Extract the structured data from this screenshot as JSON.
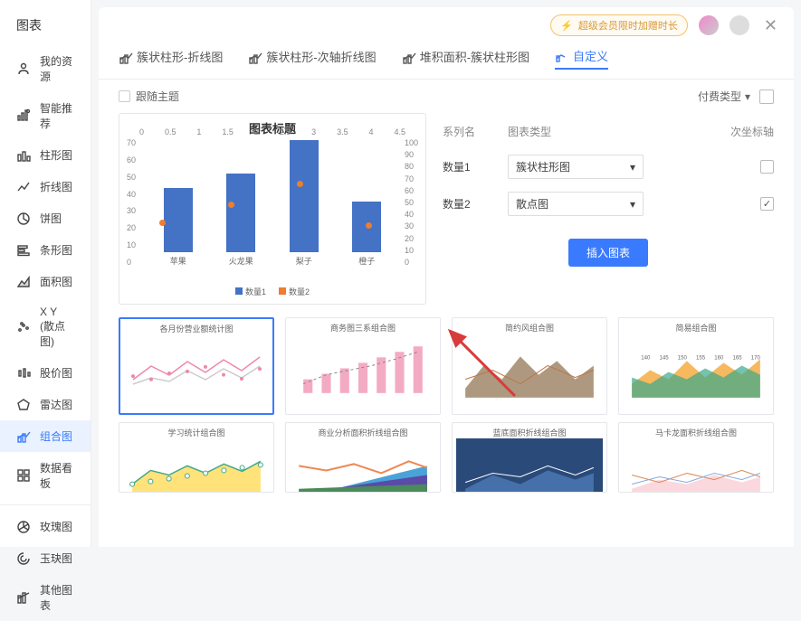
{
  "sidebar": {
    "title": "图表",
    "items": [
      {
        "label": "我的资源",
        "icon": "user"
      },
      {
        "label": "智能推荐",
        "icon": "sparkle"
      },
      {
        "label": "柱形图",
        "icon": "bar"
      },
      {
        "label": "折线图",
        "icon": "line"
      },
      {
        "label": "饼图",
        "icon": "pie"
      },
      {
        "label": "条形图",
        "icon": "hbar"
      },
      {
        "label": "面积图",
        "icon": "area"
      },
      {
        "label": "X Y (散点图)",
        "icon": "scatter"
      },
      {
        "label": "股价图",
        "icon": "stock"
      },
      {
        "label": "雷达图",
        "icon": "radar"
      },
      {
        "label": "组合图",
        "icon": "combo",
        "active": true
      },
      {
        "label": "数据看板",
        "icon": "dashboard"
      }
    ],
    "items2": [
      {
        "label": "玫瑰图",
        "icon": "rose"
      },
      {
        "label": "玉玦图",
        "icon": "jade"
      },
      {
        "label": "其他图表",
        "icon": "other"
      }
    ]
  },
  "header": {
    "vip_text": "超级会员限时加赠时长"
  },
  "tabs": [
    {
      "label": "簇状柱形-折线图"
    },
    {
      "label": "簇状柱形-次轴折线图"
    },
    {
      "label": "堆积面积-簇状柱形图"
    },
    {
      "label": "自定义",
      "active": true
    }
  ],
  "toolbar": {
    "follow_theme": "跟随主题",
    "pay_type": "付费类型"
  },
  "chart_data": {
    "type": "bar",
    "title": "图表标题",
    "categories": [
      "苹果",
      "火龙果",
      "梨子",
      "橙子"
    ],
    "series": [
      {
        "name": "数量1",
        "type": "bar",
        "values": [
          38,
          47,
          67,
          30
        ]
      },
      {
        "name": "数量2",
        "type": "scatter",
        "values": [
          35,
          50,
          68,
          32
        ]
      }
    ],
    "ylim_left": [
      0,
      70
    ],
    "yticks_left": [
      0,
      10,
      20,
      30,
      40,
      50,
      60,
      70
    ],
    "ylim_right": [
      0,
      100
    ],
    "yticks_right": [
      0,
      10,
      20,
      30,
      40,
      50,
      60,
      70,
      80,
      90,
      100
    ],
    "top_ticks": [
      "0",
      "0.5",
      "1",
      "1.5",
      "2",
      "2.5",
      "3",
      "3.5",
      "4",
      "4.5"
    ]
  },
  "config": {
    "col_series": "系列名",
    "col_type": "图表类型",
    "col_axis": "次坐标轴",
    "rows": [
      {
        "name": "数量1",
        "type": "簇状柱形图",
        "checked": false
      },
      {
        "name": "数量2",
        "type": "散点图",
        "checked": true
      }
    ],
    "insert": "插入图表"
  },
  "templates": [
    {
      "title": "各月份营业额统计图",
      "selected": true
    },
    {
      "title": "商务图三系组合图"
    },
    {
      "title": "简约风组合图"
    },
    {
      "title": "简易组合图"
    }
  ],
  "templates2": [
    {
      "title": "学习统计组合图"
    },
    {
      "title": "商业分析面积折线组合图"
    },
    {
      "title": "蓝底面积折线组合图"
    },
    {
      "title": "马卡龙面积折线组合图"
    }
  ]
}
